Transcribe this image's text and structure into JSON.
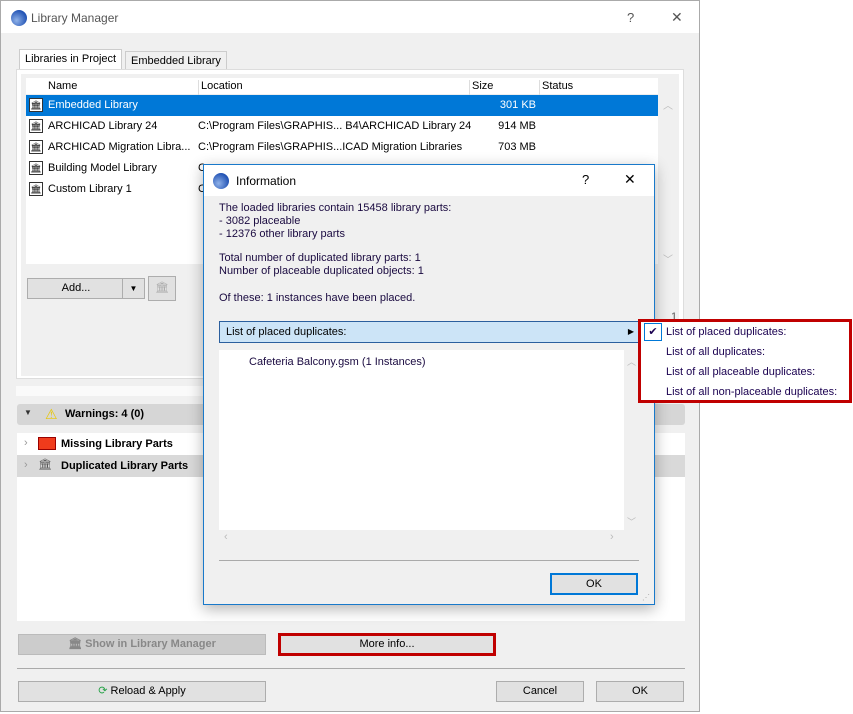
{
  "main": {
    "title": "Library Manager",
    "help": "?",
    "close": "✕",
    "tabs": [
      {
        "label": "Libraries in Project"
      },
      {
        "label": "Embedded Library"
      }
    ],
    "columns": [
      "Name",
      "Location",
      "Size",
      "Status"
    ],
    "rows": [
      {
        "name": "Embedded Library",
        "location": "",
        "size": "301 KB",
        "status": "",
        "icon": "embedded-library-icon"
      },
      {
        "name": "ARCHICAD Library 24",
        "location": "C:\\Program Files\\GRAPHIS... B4\\ARCHICAD Library 24",
        "size": "914 MB",
        "status": "",
        "icon": "folder-library-icon"
      },
      {
        "name": "ARCHICAD Migration Libra...",
        "location": "C:\\Program Files\\GRAPHIS...ICAD Migration Libraries",
        "size": "703 MB",
        "status": "",
        "icon": "folder-library-icon"
      },
      {
        "name": "Building Model Library",
        "location": "C",
        "size": "",
        "status": "",
        "icon": "folder-library-icon"
      },
      {
        "name": "Custom Library 1",
        "location": "C",
        "size": "",
        "status": "",
        "icon": "folder-library-icon"
      }
    ],
    "add_label": "Add...",
    "side_number": "1",
    "warnings": "Warnings: 4 (0)",
    "warning_items": [
      {
        "label": "Missing Library Parts"
      },
      {
        "label": "Duplicated Library Parts"
      }
    ],
    "show_in_lm": "Show in Library Manager",
    "more_info": "More info...",
    "reload": "Reload & Apply",
    "cancel": "Cancel",
    "ok": "OK"
  },
  "info": {
    "title": "Information",
    "help": "?",
    "close": "✕",
    "lines": [
      "The loaded libraries contain 15458 library parts:",
      "- 3082 placeable",
      "- 12376 other library parts",
      "Total number of duplicated library parts: 1",
      "Number of placeable duplicated objects: 1",
      "Of these: 1 instances have been placed."
    ],
    "dropdown_value": "List of placed duplicates:",
    "list_items": [
      "Cafeteria Balcony.gsm (1 Instances)"
    ],
    "ok": "OK"
  },
  "menu": {
    "items": [
      {
        "label": "List of placed duplicates:",
        "checked": true
      },
      {
        "label": "List of all duplicates:"
      },
      {
        "label": "List of all placeable duplicates:"
      },
      {
        "label": "List of all non-placeable duplicates:"
      }
    ]
  },
  "colors": {
    "selection": "#0078d7",
    "highlight_border": "#c00000",
    "dropdown_bg": "#cce4f7"
  }
}
